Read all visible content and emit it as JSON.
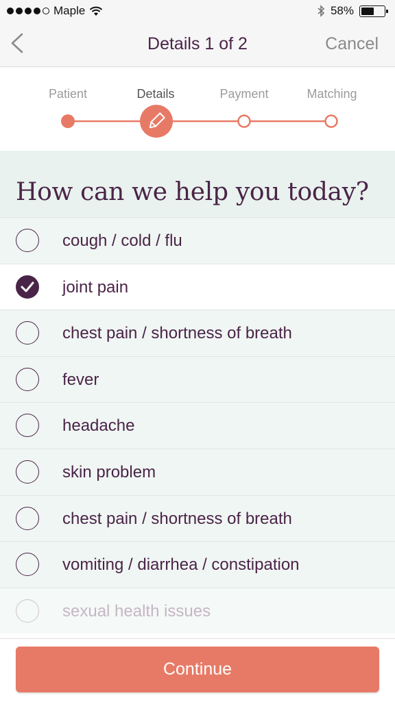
{
  "status_bar": {
    "carrier": "Maple",
    "battery": "58%",
    "battery_level": 0.58
  },
  "nav": {
    "title": "Details 1 of 2",
    "cancel_label": "Cancel"
  },
  "stepper": {
    "steps": [
      {
        "label": "Patient",
        "state": "complete"
      },
      {
        "label": "Details",
        "state": "current"
      },
      {
        "label": "Payment",
        "state": "upcoming"
      },
      {
        "label": "Matching",
        "state": "upcoming"
      }
    ],
    "accent_color": "#e77a66"
  },
  "question": {
    "title": "How can we help you today?"
  },
  "options": [
    {
      "label": "cough / cold / flu",
      "selected": false
    },
    {
      "label": "joint pain",
      "selected": true
    },
    {
      "label": "chest pain / shortness of breath",
      "selected": false
    },
    {
      "label": "fever",
      "selected": false
    },
    {
      "label": "headache",
      "selected": false
    },
    {
      "label": "skin problem",
      "selected": false
    },
    {
      "label": "chest pain / shortness of breath",
      "selected": false
    },
    {
      "label": "vomiting / diarrhea / constipation",
      "selected": false
    },
    {
      "label": "sexual health issues",
      "selected": false
    }
  ],
  "footer": {
    "continue_label": "Continue"
  },
  "colors": {
    "brand_purple": "#4a2448",
    "accent_coral": "#e77a66",
    "list_background": "#f0f6f3"
  }
}
